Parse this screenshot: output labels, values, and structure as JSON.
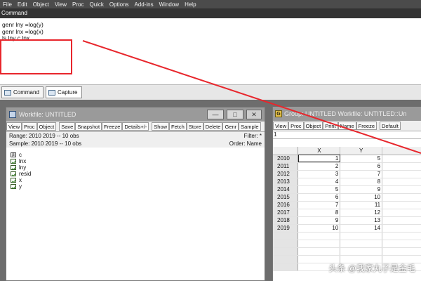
{
  "menu": [
    "File",
    "Edit",
    "Object",
    "View",
    "Proc",
    "Quick",
    "Options",
    "Add-ins",
    "Window",
    "Help"
  ],
  "command_window": {
    "title": "Command",
    "lines": [
      "genr lny =log(y)",
      "genr lnx =log(x)",
      "ls lny c lnx"
    ],
    "highlight_color": "#e8262c",
    "tabs": [
      "Command",
      "Capture"
    ]
  },
  "workfile": {
    "title": "Workfile: UNTITLED",
    "toolbar_left": [
      "View",
      "Proc",
      "Object"
    ],
    "toolbar_mid": [
      "Save",
      "Snapshot",
      "Freeze",
      "Details+/-"
    ],
    "toolbar_right": [
      "Show",
      "Fetch",
      "Store",
      "Delete",
      "Genr",
      "Sample"
    ],
    "range_label": "Range:  2010 2019   --   10 obs",
    "sample_label": "Sample: 2010 2019   --   10 obs",
    "filter": "Filter: *",
    "order": "Order: Name",
    "objects": [
      {
        "name": "c",
        "icon": "coef-icon"
      },
      {
        "name": "lnx",
        "icon": "series-icon"
      },
      {
        "name": "lny",
        "icon": "series-icon"
      },
      {
        "name": "resid",
        "icon": "series-icon"
      },
      {
        "name": "x",
        "icon": "series-icon"
      },
      {
        "name": "y",
        "icon": "series-icon"
      }
    ]
  },
  "group": {
    "title": "Group: UNTITLED   Workfile: UNTITLED::Un",
    "toolbar": [
      "View",
      "Proc",
      "Object",
      "Print",
      "Name",
      "Freeze"
    ],
    "default_label": "Default",
    "row_indicator": "1",
    "columns": [
      "X",
      "Y"
    ],
    "rows": [
      {
        "obs": "2010",
        "x": "1",
        "y": "5"
      },
      {
        "obs": "2011",
        "x": "2",
        "y": "6"
      },
      {
        "obs": "2012",
        "x": "3",
        "y": "7"
      },
      {
        "obs": "2013",
        "x": "4",
        "y": "8"
      },
      {
        "obs": "2014",
        "x": "5",
        "y": "9"
      },
      {
        "obs": "2015",
        "x": "6",
        "y": "10"
      },
      {
        "obs": "2016",
        "x": "7",
        "y": "11"
      },
      {
        "obs": "2017",
        "x": "8",
        "y": "12"
      },
      {
        "obs": "2018",
        "x": "9",
        "y": "13"
      },
      {
        "obs": "2019",
        "x": "10",
        "y": "14"
      }
    ]
  },
  "watermark": "头条 @我家丸子是金毛",
  "arrow_color": "#e8262c"
}
